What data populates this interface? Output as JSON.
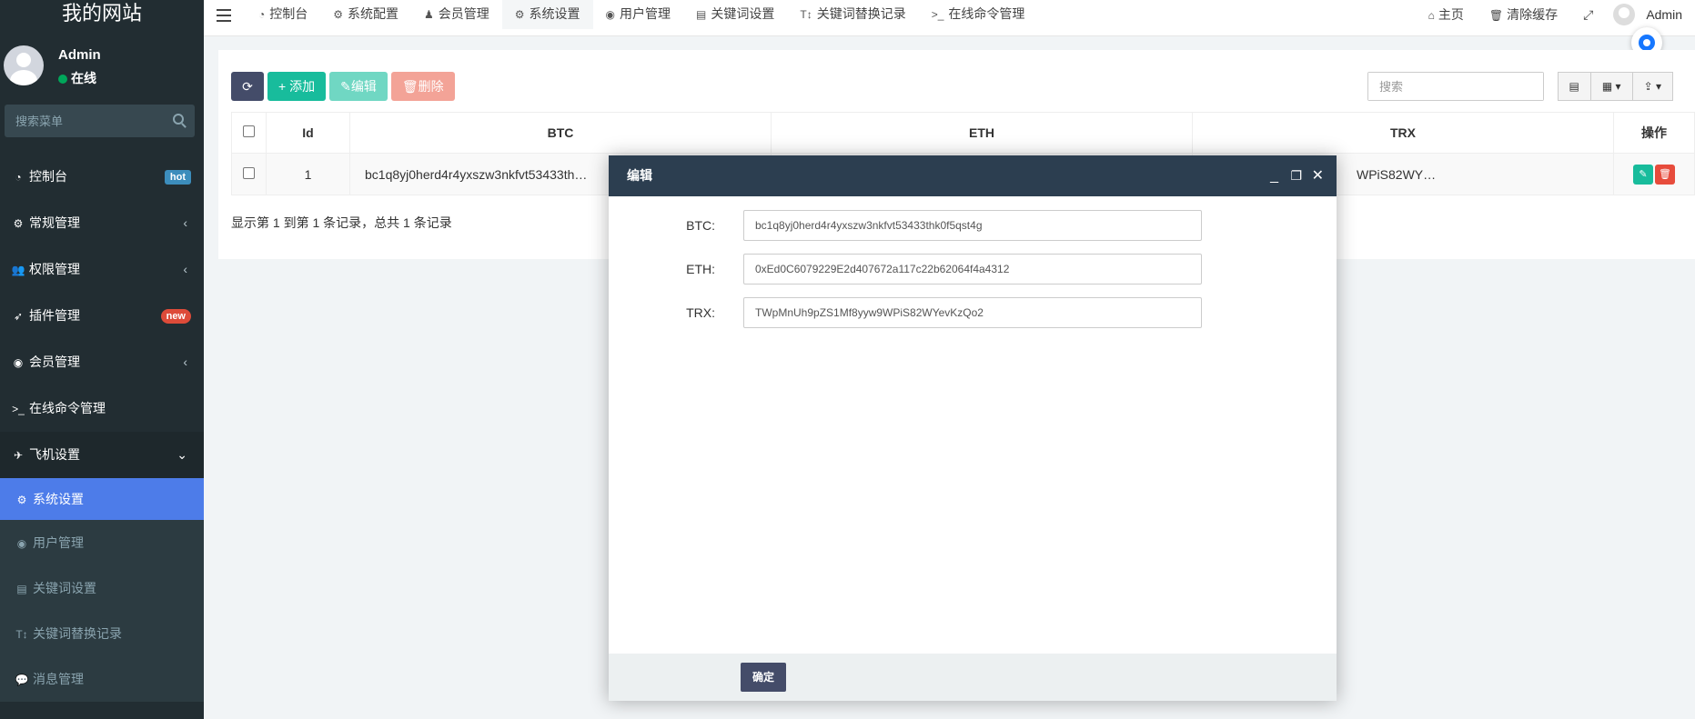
{
  "sidebar": {
    "site_name": "我的网站",
    "user_name": "Admin",
    "user_status": "在线",
    "search_placeholder": "搜索菜单",
    "items": [
      {
        "label": "控制台",
        "icon": "dashboard-icon",
        "badge": "hot"
      },
      {
        "label": "常规管理",
        "icon": "cogs-icon"
      },
      {
        "label": "权限管理",
        "icon": "group-icon"
      },
      {
        "label": "插件管理",
        "icon": "rocket-icon",
        "badge": "new"
      },
      {
        "label": "会员管理",
        "icon": "user-circle-icon"
      },
      {
        "label": "在线命令管理",
        "icon": "terminal-icon"
      },
      {
        "label": "飞机设置",
        "icon": "telegram-icon"
      }
    ],
    "submenu": [
      {
        "label": "系统设置",
        "icon": "gear-icon",
        "active": true
      },
      {
        "label": "用户管理",
        "icon": "user-circle-icon"
      },
      {
        "label": "关键词设置",
        "icon": "file-icon"
      },
      {
        "label": "关键词替换记录",
        "icon": "text-height-icon"
      },
      {
        "label": "消息管理",
        "icon": "comment-icon"
      }
    ]
  },
  "navbar": {
    "tabs": [
      {
        "label": "控制台",
        "icon": "dashboard-icon"
      },
      {
        "label": "系统配置",
        "icon": "gear-icon"
      },
      {
        "label": "会员管理",
        "icon": "user-icon"
      },
      {
        "label": "系统设置",
        "icon": "gear-icon",
        "active": true
      },
      {
        "label": "用户管理",
        "icon": "user-circle-icon"
      },
      {
        "label": "关键词设置",
        "icon": "file-icon"
      },
      {
        "label": "关键词替换记录",
        "icon": "text-height-icon"
      },
      {
        "label": "在线命令管理",
        "icon": "terminal-icon"
      }
    ],
    "home": "主页",
    "clear_cache": "清除缓存",
    "admin": "Admin"
  },
  "toolbar": {
    "add": "添加",
    "edit": "编辑",
    "delete": "删除",
    "search_placeholder": "搜索"
  },
  "table": {
    "columns": [
      "Id",
      "BTC",
      "ETH",
      "TRX",
      "操作"
    ],
    "rows": [
      {
        "id": "1",
        "btc": "bc1q8yj0herd4r4yxszw3nkfvt53433th…",
        "eth": "",
        "trx": "WPiS82WY…"
      }
    ]
  },
  "page_info": "显示第 1 到第 1 条记录，总共 1 条记录",
  "modal": {
    "title": "编辑",
    "fields": [
      {
        "label": "BTC:",
        "value": "bc1q8yj0herd4r4yxszw3nkfvt53433thk0f5qst4g"
      },
      {
        "label": "ETH:",
        "value": "0xEd0C6079229E2d407672a117c22b62064f4a4312"
      },
      {
        "label": "TRX:",
        "value": "TWpMnUh9pZS1Mf8yyw9WPiS82WYevKzQo2"
      }
    ],
    "confirm": "确定"
  },
  "colors": {
    "sidebar_bg": "#222d32",
    "active_menu": "#4d7ce9",
    "modal_header": "#2c3e50",
    "success": "#18bc9c",
    "danger": "#e74c3c"
  }
}
